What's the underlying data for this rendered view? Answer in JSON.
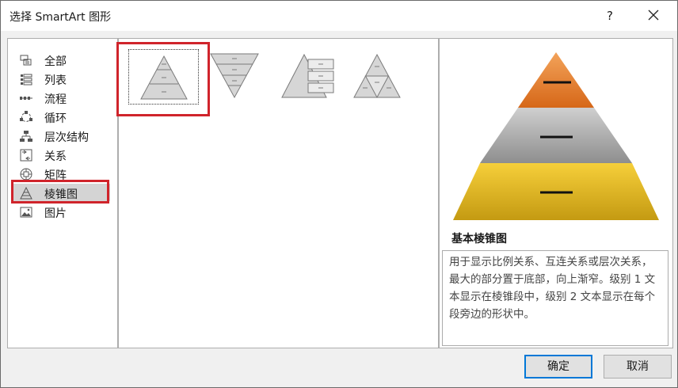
{
  "window": {
    "title": "选择 SmartArt 图形",
    "help": "?",
    "close_icon": "close-icon"
  },
  "categories": [
    {
      "label": "全部",
      "icon": "all-icon"
    },
    {
      "label": "列表",
      "icon": "list-icon"
    },
    {
      "label": "流程",
      "icon": "process-icon"
    },
    {
      "label": "循环",
      "icon": "cycle-icon"
    },
    {
      "label": "层次结构",
      "icon": "hierarchy-icon"
    },
    {
      "label": "关系",
      "icon": "relationship-icon"
    },
    {
      "label": "矩阵",
      "icon": "matrix-icon"
    },
    {
      "label": "棱锥图",
      "icon": "pyramid-icon",
      "selected": true
    },
    {
      "label": "图片",
      "icon": "picture-icon"
    }
  ],
  "gallery": [
    {
      "name": "basic-pyramid",
      "selected": true
    },
    {
      "name": "inverted-pyramid"
    },
    {
      "name": "pyramid-list"
    },
    {
      "name": "segmented-pyramid"
    }
  ],
  "preview": {
    "title": "基本棱锥图",
    "description": "用于显示比例关系、互连关系或层次关系，最大的部分置于底部，向上渐窄。级别 1 文本显示在棱锥段中，级别 2 文本显示在每个段旁边的形状中。",
    "colors": {
      "top": "#e87722",
      "middle": "#8c8c8c",
      "bottom": "#e8b822"
    }
  },
  "buttons": {
    "ok": "确定",
    "cancel": "取消"
  },
  "accent": {
    "highlight": "#d0242b",
    "focus": "#0078d7"
  }
}
